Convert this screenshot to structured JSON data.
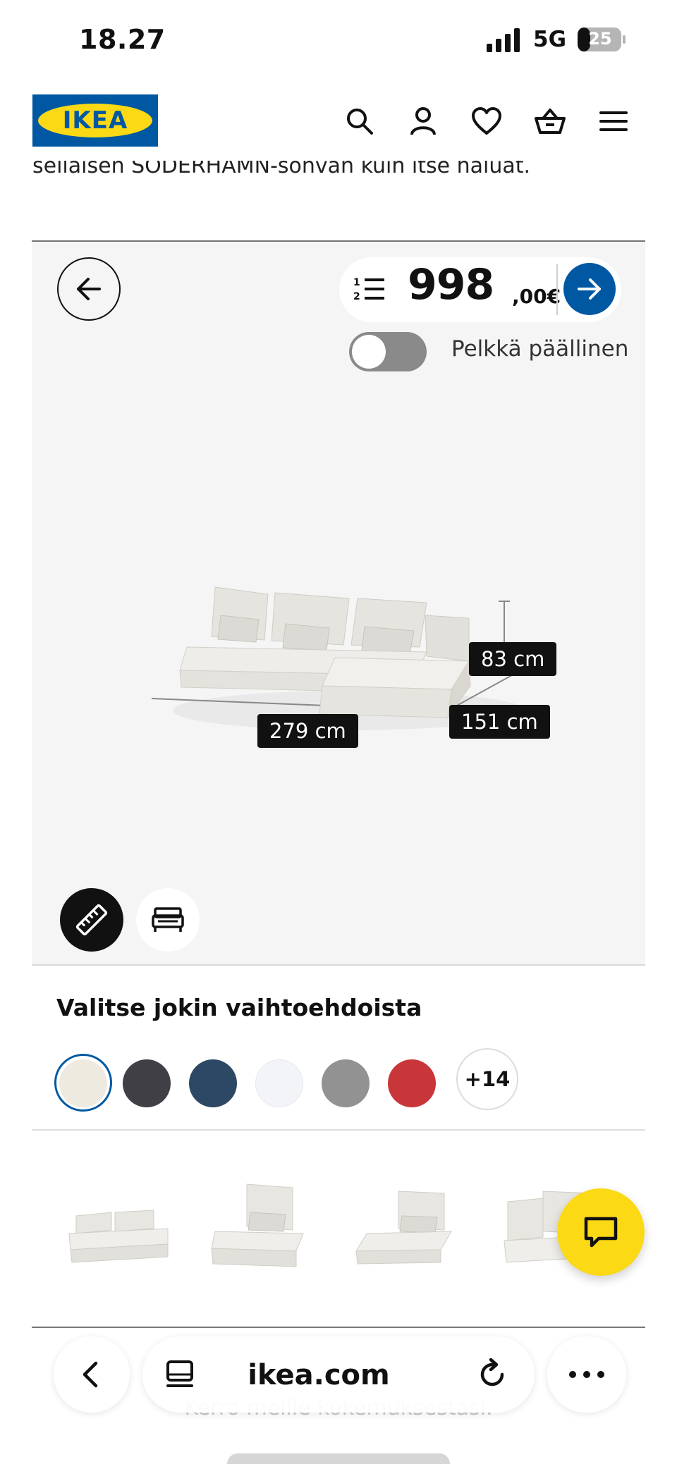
{
  "status_bar": {
    "time": "18.27",
    "network": "5G",
    "battery": "25"
  },
  "header": {
    "logo_text": "IKEA",
    "icons": [
      "search-icon",
      "user-icon",
      "heart-icon",
      "basket-icon",
      "menu-icon"
    ]
  },
  "intro_text": "sellaisen SÖDERHAMN-sohvan kuin itse haluat.",
  "viewer": {
    "price_integer": "998",
    "price_decimal": ",00€",
    "toggle_label": "Pelkkä päällinen",
    "toggle_on": false,
    "dimensions": {
      "height": "83 cm",
      "width": "279 cm",
      "depth": "151 cm"
    },
    "tools": [
      "ruler-icon",
      "room-icon"
    ]
  },
  "variants": {
    "title": "Valitse jokin vaihtoehdoista",
    "colors": [
      "#efeadf",
      "#3f3f45",
      "#2c4864",
      "#f2f4f8",
      "#929292",
      "#c8363a"
    ],
    "selected_index": 0,
    "more_label": "+14"
  },
  "modules": [
    "2-seat section",
    "1-seat section",
    "chaise longue",
    "corner section"
  ],
  "feedback_text": "Kerro meille kokemuksestasi.",
  "browser": {
    "url": "ikea.com"
  }
}
